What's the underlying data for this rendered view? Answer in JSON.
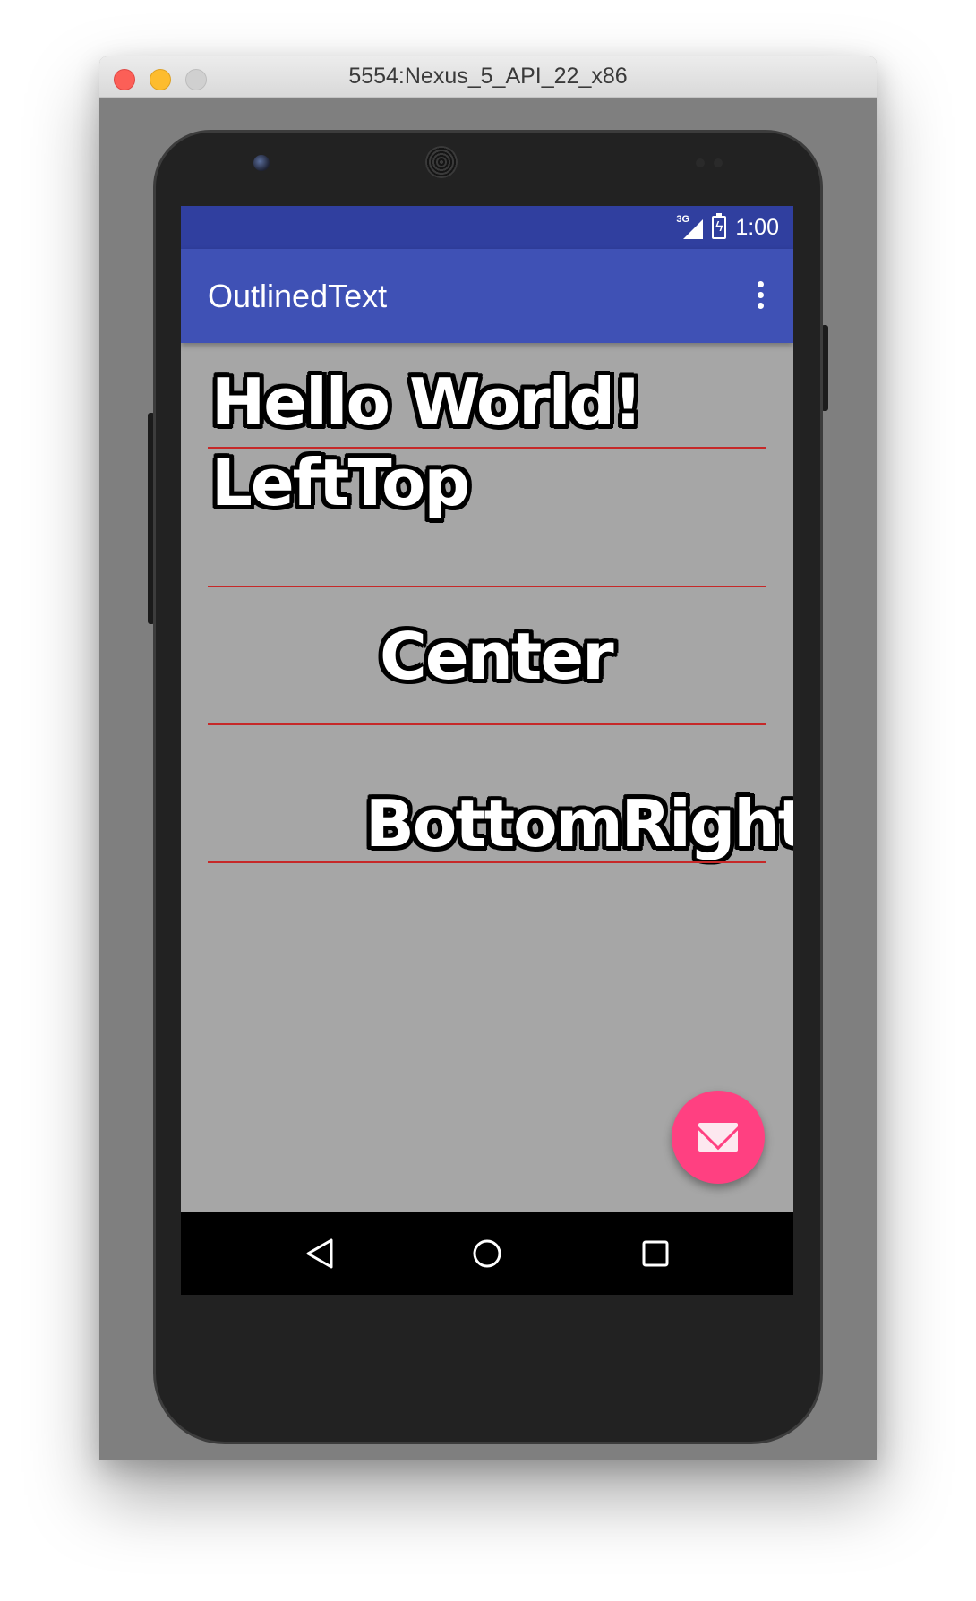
{
  "window": {
    "title": "5554:Nexus_5_API_22_x86"
  },
  "statusbar": {
    "network": "3G",
    "time": "1:00"
  },
  "appbar": {
    "title": "OutlinedText"
  },
  "content": {
    "hello": "Hello World!",
    "lefttop": "LeftTop",
    "center": "Center",
    "bottomright": "BottomRight"
  },
  "colors": {
    "statusbar": "#303f9f",
    "appbar": "#3f51b5",
    "background": "#a6a6a6",
    "guide_line": "#c62828",
    "fab": "#ff4081"
  },
  "icons": {
    "fab": "envelope-icon",
    "nav_back": "back-triangle-icon",
    "nav_home": "home-circle-icon",
    "nav_recent": "recents-square-icon",
    "menu": "overflow-menu-icon"
  }
}
